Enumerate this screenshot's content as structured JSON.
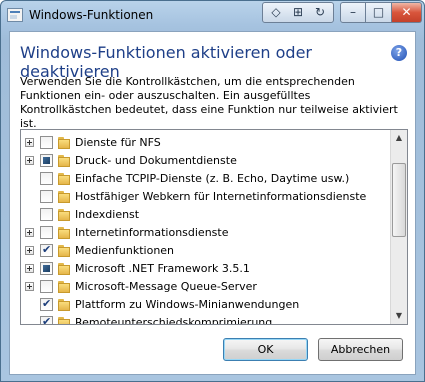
{
  "window": {
    "title": "Windows-Funktionen"
  },
  "titlebar_buttons": {
    "group": [
      "◇",
      "⊞",
      "↻"
    ],
    "minimize": "–",
    "maximize": "□",
    "close": "✕"
  },
  "dialog": {
    "heading": "Windows-Funktionen aktivieren oder deaktivieren",
    "help": "?",
    "description": "Verwenden Sie die Kontrollkästchen, um die entsprechenden Funktionen ein- oder auszuschalten. Ein ausgefülltes Kontrollkästchen bedeutet, dass eine Funktion nur teilweise aktiviert ist."
  },
  "features": [
    {
      "label": "Dienste für NFS",
      "expandable": true,
      "state": "unchecked"
    },
    {
      "label": "Druck- und Dokumentdienste",
      "expandable": true,
      "state": "partial"
    },
    {
      "label": "Einfache TCPIP-Dienste (z. B. Echo, Daytime usw.)",
      "expandable": false,
      "state": "unchecked"
    },
    {
      "label": "Hostfähiger Webkern für Internetinformationsdienste",
      "expandable": false,
      "state": "unchecked"
    },
    {
      "label": "Indexdienst",
      "expandable": false,
      "state": "unchecked"
    },
    {
      "label": "Internetinformationsdienste",
      "expandable": true,
      "state": "unchecked"
    },
    {
      "label": "Medienfunktionen",
      "expandable": true,
      "state": "checked"
    },
    {
      "label": "Microsoft .NET Framework 3.5.1",
      "expandable": true,
      "state": "partial"
    },
    {
      "label": "Microsoft-Message Queue-Server",
      "expandable": true,
      "state": "unchecked"
    },
    {
      "label": "Plattform zu Windows-Minianwendungen",
      "expandable": false,
      "state": "checked"
    },
    {
      "label": "Remoteunterschiedskomprimierung",
      "expandable": false,
      "state": "checked"
    }
  ],
  "buttons": {
    "ok": "OK",
    "cancel": "Abbrechen"
  }
}
